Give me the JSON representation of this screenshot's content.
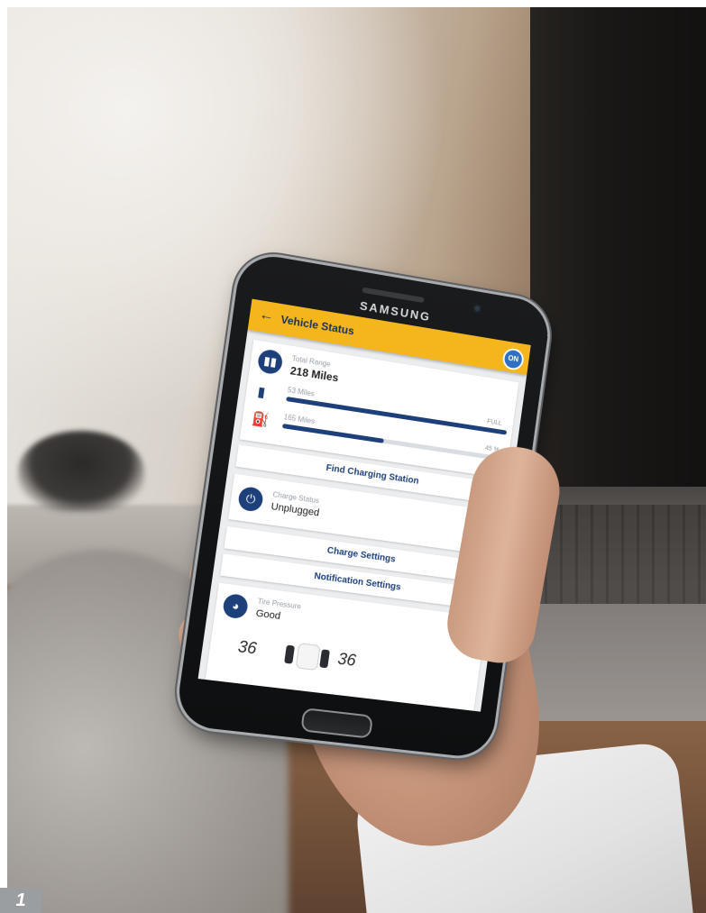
{
  "phone": {
    "brand": "SAMSUNG"
  },
  "app": {
    "title": "Vehicle Status",
    "badge_text": "ON",
    "colors": {
      "app_bar": "#f4b61c",
      "accent": "#1d3f7a",
      "screen_bg": "#ecedef"
    },
    "range": {
      "label": "Total Range",
      "value": "218 Miles",
      "battery": {
        "miles": "53 Miles",
        "percent": "FULL",
        "fill_fraction": 1.0
      },
      "fuel": {
        "miles": "165 Miles",
        "percent": "45 %",
        "fill_fraction": 0.45
      }
    },
    "find_charging_label": "Find Charging Station",
    "charge": {
      "label": "Charge Status",
      "value": "Unplugged"
    },
    "charge_settings_label": "Charge Settings",
    "notification_settings_label": "Notification Settings",
    "tire": {
      "label": "Tire Pressure",
      "value": "Good",
      "front_left": "36",
      "front_right": "36"
    }
  },
  "figure": {
    "number": "1"
  }
}
